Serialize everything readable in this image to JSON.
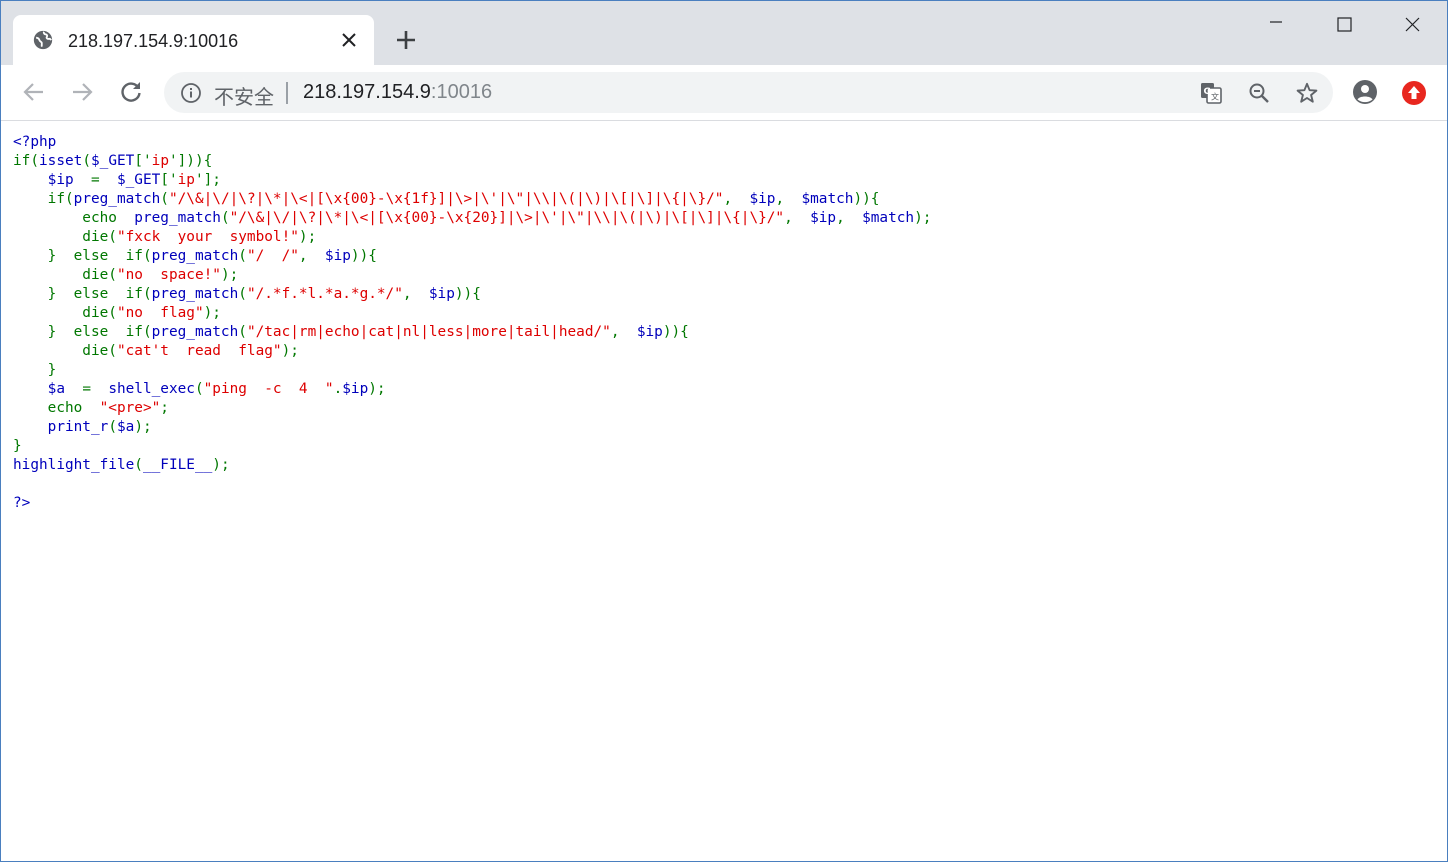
{
  "browser": {
    "tab": {
      "title": "218.197.154.9:10016",
      "favicon": "globe-icon"
    },
    "new_tab_icon": "plus-icon",
    "window_controls": [
      "minimize-icon",
      "maximize-icon",
      "close-icon"
    ],
    "toolbar": {
      "security_label": "不安全",
      "url_host": "218.197.154.9",
      "url_port": ":10016",
      "icons": [
        "back-icon",
        "forward-icon",
        "reload-icon",
        "info-icon",
        "translate-icon",
        "zoom-out-icon",
        "star-icon",
        "profile-icon",
        "extension-icon"
      ]
    }
  },
  "colors": {
    "html": "#0000bb",
    "keyword": "#007700",
    "string": "#dd0000"
  },
  "code_lines": [
    [
      [
        "d",
        "<?php"
      ]
    ],
    [
      [
        "k",
        "if("
      ],
      [
        "d",
        "isset"
      ],
      [
        "k",
        "("
      ],
      [
        "d",
        "$_GET"
      ],
      [
        "k",
        "['"
      ],
      [
        "s",
        "ip"
      ],
      [
        "k",
        "'])){"
      ]
    ],
    [
      [
        "d",
        "    $ip  "
      ],
      [
        "k",
        "=  "
      ],
      [
        "d",
        "$_GET"
      ],
      [
        "k",
        "['"
      ],
      [
        "s",
        "ip"
      ],
      [
        "k",
        "'];"
      ]
    ],
    [
      [
        "k",
        "    if("
      ],
      [
        "d",
        "preg_match"
      ],
      [
        "k",
        "("
      ],
      [
        "s",
        "\"/\\&|\\/|\\?|\\*|\\<|[\\x{00}-\\x{1f}]|\\>|\\'|\\\"|\\\\|\\(|\\)|\\[|\\]|\\{|\\}/\""
      ],
      [
        "k",
        ",  "
      ],
      [
        "d",
        "$ip"
      ],
      [
        "k",
        ",  "
      ],
      [
        "d",
        "$match"
      ],
      [
        "k",
        "))"
      ],
      [
        "k",
        "{"
      ]
    ],
    [
      [
        "k",
        "        echo  "
      ],
      [
        "d",
        "preg_match"
      ],
      [
        "k",
        "("
      ],
      [
        "s",
        "\"/\\&|\\/|\\?|\\*|\\<|[\\x{00}-\\x{20}]|\\>|\\'|\\\"|\\\\|\\(|\\)|\\[|\\]|\\{|\\}/\""
      ],
      [
        "k",
        ",  "
      ],
      [
        "d",
        "$ip"
      ],
      [
        "k",
        ",  "
      ],
      [
        "d",
        "$match"
      ],
      [
        "k",
        ");"
      ]
    ],
    [
      [
        "k",
        "        die("
      ],
      [
        "s",
        "\"fxck  your  symbol!\""
      ],
      [
        "k",
        ");"
      ]
    ],
    [
      [
        "k",
        "    }  else  if("
      ],
      [
        "d",
        "preg_match"
      ],
      [
        "k",
        "("
      ],
      [
        "s",
        "\"/  /\""
      ],
      [
        "k",
        ",  "
      ],
      [
        "d",
        "$ip"
      ],
      [
        "k",
        "))"
      ],
      [
        "k",
        "{"
      ]
    ],
    [
      [
        "k",
        "        die("
      ],
      [
        "s",
        "\"no  space!\""
      ],
      [
        "k",
        ");"
      ]
    ],
    [
      [
        "k",
        "    }  else  if("
      ],
      [
        "d",
        "preg_match"
      ],
      [
        "k",
        "("
      ],
      [
        "s",
        "\"/.*f.*l.*a.*g.*/\""
      ],
      [
        "k",
        ",  "
      ],
      [
        "d",
        "$ip"
      ],
      [
        "k",
        "))"
      ],
      [
        "k",
        "{"
      ]
    ],
    [
      [
        "k",
        "        die("
      ],
      [
        "s",
        "\"no  flag\""
      ],
      [
        "k",
        ");"
      ]
    ],
    [
      [
        "k",
        "    }  else  if("
      ],
      [
        "d",
        "preg_match"
      ],
      [
        "k",
        "("
      ],
      [
        "s",
        "\"/tac|rm|echo|cat|nl|less|more|tail|head/\""
      ],
      [
        "k",
        ",  "
      ],
      [
        "d",
        "$ip"
      ],
      [
        "k",
        "))"
      ],
      [
        "k",
        "{"
      ]
    ],
    [
      [
        "k",
        "        die("
      ],
      [
        "s",
        "\"cat't  read  flag\""
      ],
      [
        "k",
        ");"
      ]
    ],
    [
      [
        "k",
        "    }"
      ]
    ],
    [
      [
        "d",
        "    $a  "
      ],
      [
        "k",
        "=  "
      ],
      [
        "d",
        "shell_exec"
      ],
      [
        "k",
        "("
      ],
      [
        "s",
        "\"ping  -c  4  \""
      ],
      [
        "k",
        "."
      ],
      [
        "d",
        "$ip"
      ],
      [
        "k",
        ");"
      ]
    ],
    [
      [
        "k",
        "    echo  "
      ],
      [
        "s",
        "\"<pre>\""
      ],
      [
        "k",
        ";"
      ]
    ],
    [
      [
        "d",
        "    print_r"
      ],
      [
        "k",
        "("
      ],
      [
        "d",
        "$a"
      ],
      [
        "k",
        ");"
      ]
    ],
    [
      [
        "k",
        "}"
      ]
    ],
    [
      [
        "d",
        "highlight_file"
      ],
      [
        "k",
        "("
      ],
      [
        "d",
        "__FILE__"
      ],
      [
        "k",
        ");"
      ]
    ],
    [
      [
        "d",
        ""
      ]
    ],
    [
      [
        "d",
        "?>"
      ]
    ]
  ]
}
